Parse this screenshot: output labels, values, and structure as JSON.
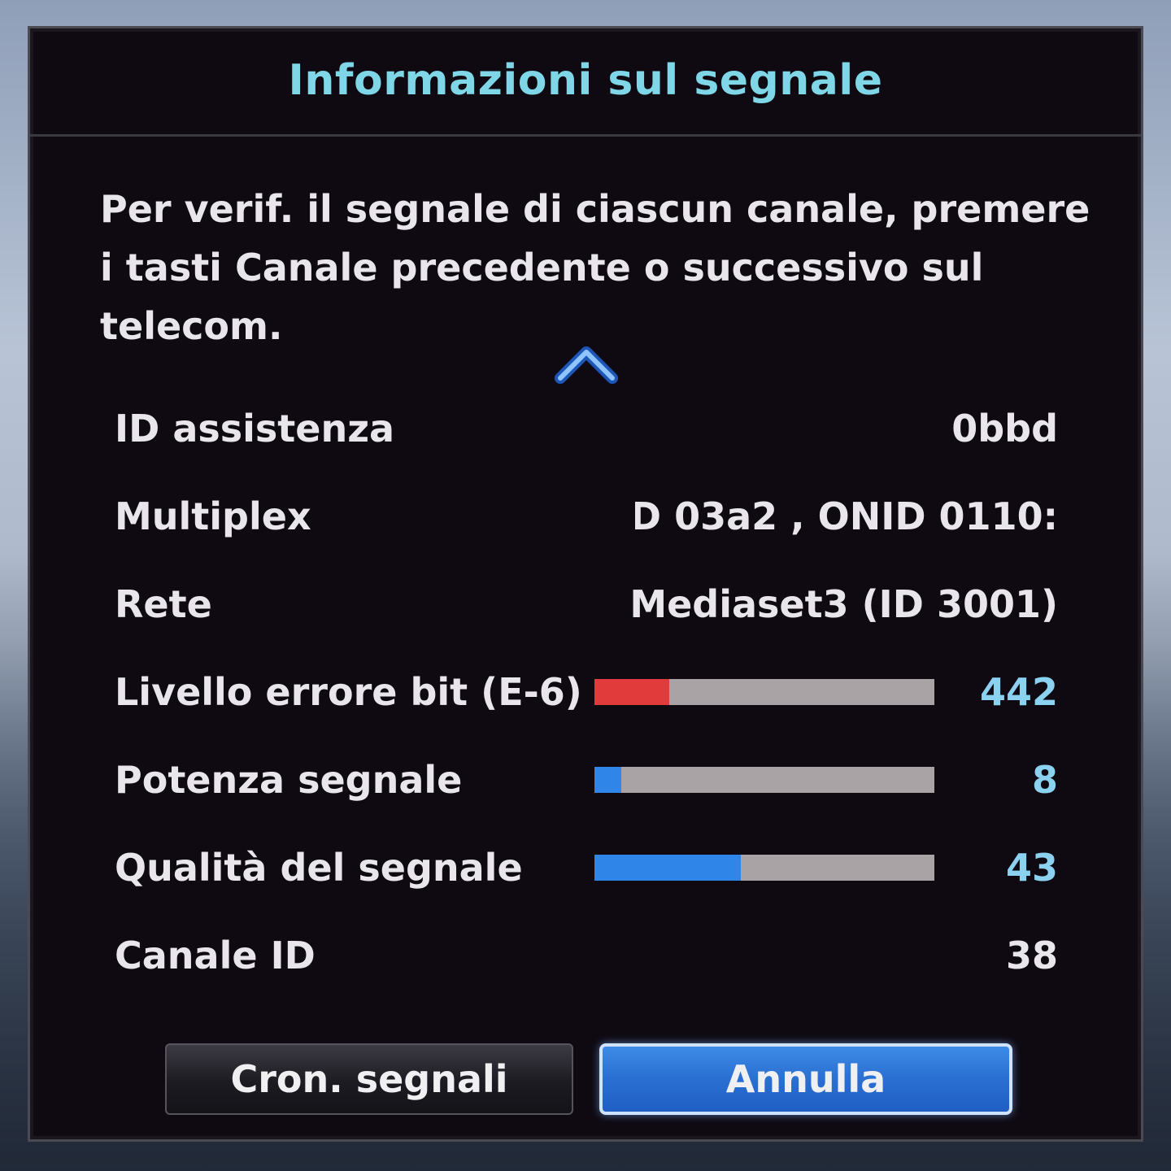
{
  "dialog": {
    "title": "Informazioni sul segnale",
    "description": "Per verif. il segnale di ciascun canale, premere i tasti Canale precedente o successivo sul telecom.",
    "scroll_up_icon": "chevron-up-icon"
  },
  "rows": {
    "service_id": {
      "label": "ID assistenza",
      "value": "0bbd"
    },
    "multiplex": {
      "label": "Multiplex",
      "value": ":ID 03a2 , ONID 0110)"
    },
    "network": {
      "label": "Rete",
      "value": "Mediaset3 (ID 3001)"
    },
    "bit_error": {
      "label": "Livello errore bit (E-6)",
      "value": "442",
      "bar_fraction": 0.22,
      "bar_color": "#e23b3b"
    },
    "signal_strength": {
      "label": "Potenza segnale",
      "value": "8",
      "bar_fraction": 0.08,
      "bar_color": "#2f86e8"
    },
    "signal_quality": {
      "label": "Qualità del segnale",
      "value": "43",
      "bar_fraction": 0.43,
      "bar_color": "#2f86e8"
    },
    "channel_id": {
      "label": "Canale ID",
      "value": "38"
    }
  },
  "buttons": {
    "signal_monitor": "Cron. segnali",
    "cancel": "Annulla"
  },
  "colors": {
    "title": "#7fd6e6",
    "value_numeric": "#8ad2f0",
    "primary_button": "#2a6fd2"
  }
}
